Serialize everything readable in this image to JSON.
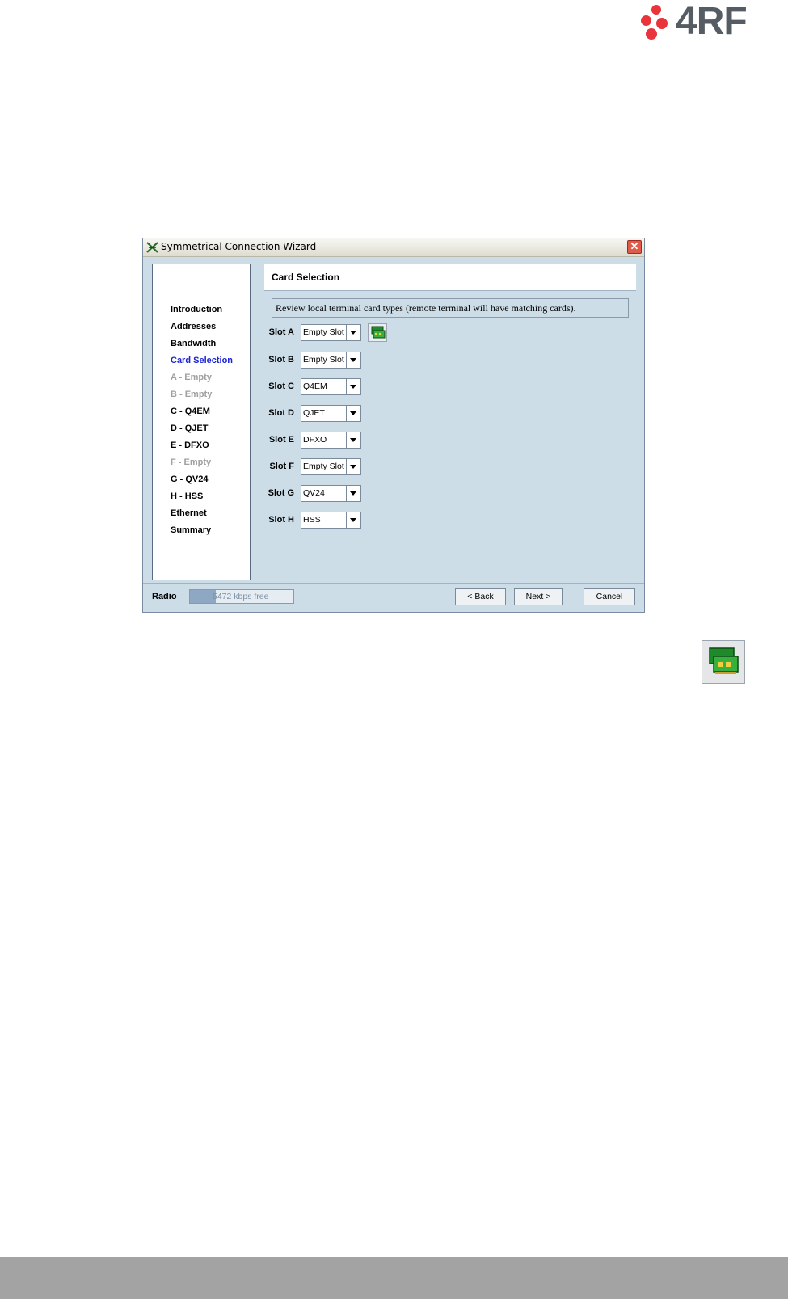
{
  "brand": {
    "logo_text": "4RF",
    "accent": "#e8343a"
  },
  "window": {
    "title": "Symmetrical Connection Wizard",
    "close_glyph": "✕",
    "icon": "wizard-icon"
  },
  "nav": {
    "items": [
      {
        "label": "Introduction",
        "state": "normal"
      },
      {
        "label": "Addresses",
        "state": "normal"
      },
      {
        "label": "Bandwidth",
        "state": "normal"
      },
      {
        "label": "Card Selection",
        "state": "active"
      },
      {
        "label": "A - Empty",
        "state": "disabled"
      },
      {
        "label": "B - Empty",
        "state": "disabled"
      },
      {
        "label": "C - Q4EM",
        "state": "normal"
      },
      {
        "label": "D - QJET",
        "state": "normal"
      },
      {
        "label": "E - DFXO",
        "state": "normal"
      },
      {
        "label": "F - Empty",
        "state": "disabled"
      },
      {
        "label": "G - QV24",
        "state": "normal"
      },
      {
        "label": "H - HSS",
        "state": "normal"
      },
      {
        "label": "Ethernet",
        "state": "normal"
      },
      {
        "label": "Summary",
        "state": "normal"
      }
    ]
  },
  "content": {
    "heading": "Card Selection",
    "description": "Review local terminal card types (remote terminal will have matching cards).",
    "slots": [
      {
        "label": "Slot A",
        "value": "Empty Slot"
      },
      {
        "label": "Slot B",
        "value": "Empty Slot"
      },
      {
        "label": "Slot C",
        "value": "Q4EM"
      },
      {
        "label": "Slot D",
        "value": "QJET"
      },
      {
        "label": "Slot E",
        "value": "DFXO"
      },
      {
        "label": "Slot F",
        "value": "Empty Slot"
      },
      {
        "label": "Slot G",
        "value": "QV24"
      },
      {
        "label": "Slot H",
        "value": "HSS"
      }
    ]
  },
  "footer": {
    "radio_label": "Radio",
    "bandwidth_text": "5472 kbps free",
    "bandwidth_used_fraction": 0.25,
    "back_label": "< Back",
    "next_label": "Next >",
    "cancel_label": "Cancel"
  }
}
